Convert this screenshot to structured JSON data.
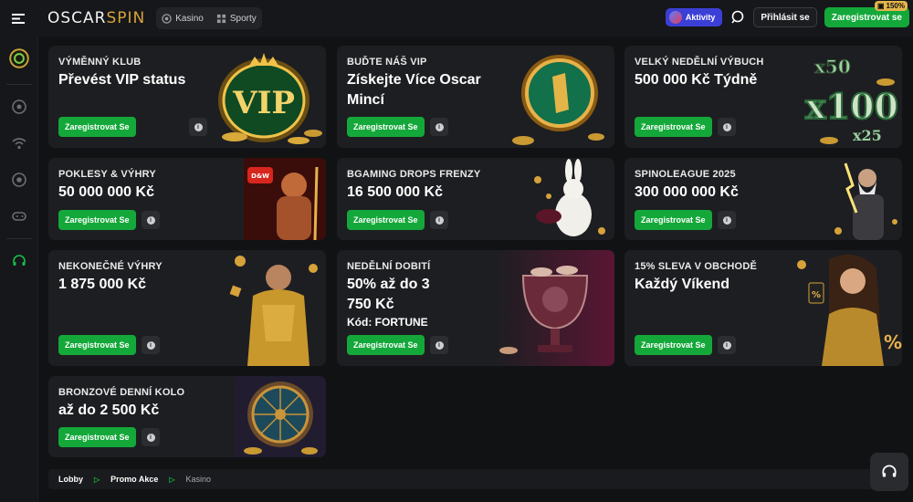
{
  "header": {
    "logo_main": "OSCAR",
    "logo_accent": "SPIN",
    "nav_tabs": [
      {
        "label": "Kasino",
        "icon": "casino-chip-icon"
      },
      {
        "label": "Sporty",
        "icon": "sports-grid-icon"
      }
    ],
    "activity_label": "Aktivity",
    "login_label": "Přihlásit se",
    "register_label": "Zaregistrovat se",
    "bonus_badge": "150%"
  },
  "sidebar": {
    "items": [
      "vip-coin-icon",
      "casino-chip-icon",
      "live-signal-icon",
      "football-icon",
      "gamepad-icon",
      "support-headset-icon"
    ]
  },
  "promos": [
    {
      "label": "VÝMĚNNÝ KLUB",
      "title": "Převést VIP status",
      "cta": "Zaregistrovat Se",
      "art": "vip-crown-badge"
    },
    {
      "label": "BUĎTE NÁŠ VIP",
      "title": "Získejte Více Oscar Mincí",
      "cta": "Zaregistrovat Se",
      "art": "oscar-coin"
    },
    {
      "label": "VELKÝ NEDĚLNÍ VÝBUCH",
      "title": "500 000 Kč Týdně",
      "cta": "Zaregistrovat Se",
      "art": "multiplier-x100"
    },
    {
      "label": "POKLESY & VÝHRY",
      "title": "50 000 000 Kč",
      "cta": "Zaregistrovat Se",
      "art": "drops-wins-warrior"
    },
    {
      "label": "BGAMING DROPS FRENZY",
      "title": "16 500 000 Kč",
      "cta": "Zaregistrovat Se",
      "art": "white-rabbit"
    },
    {
      "label": "SPINOLEAGUE 2025",
      "title": "300 000 000 Kč",
      "cta": "Zaregistrovat Se",
      "art": "zeus-lightning"
    },
    {
      "label": "NEKONEČNÉ VÝHRY",
      "title": "1 875 000 Kč",
      "cta": "Zaregistrovat Se",
      "art": "gold-astronaut"
    },
    {
      "label": "NEDĚLNÍ DOBITÍ",
      "title": "50% až do 3 750 Kč",
      "code": "Kód: FORTUNE",
      "cta": "Zaregistrovat Se",
      "art": "trophy-cup"
    },
    {
      "label": "15% SLEVA V OBCHODĚ",
      "title": "Každý Víkend",
      "cta": "Zaregistrovat Se",
      "art": "woman-gold-dress"
    },
    {
      "label": "BRONZOVÉ DENNÍ KOLO",
      "title": "až do 2 500 Kč",
      "cta": "Zaregistrovat Se",
      "art": "bronze-wheel"
    }
  ],
  "breadcrumb": [
    "Lobby",
    "Promo Akce",
    "Kasino"
  ],
  "colors": {
    "accent_green": "#14a83a",
    "gold": "#d8a33b",
    "activity_blue": "#3b3fd6",
    "card_bg": "#1d1e21"
  }
}
